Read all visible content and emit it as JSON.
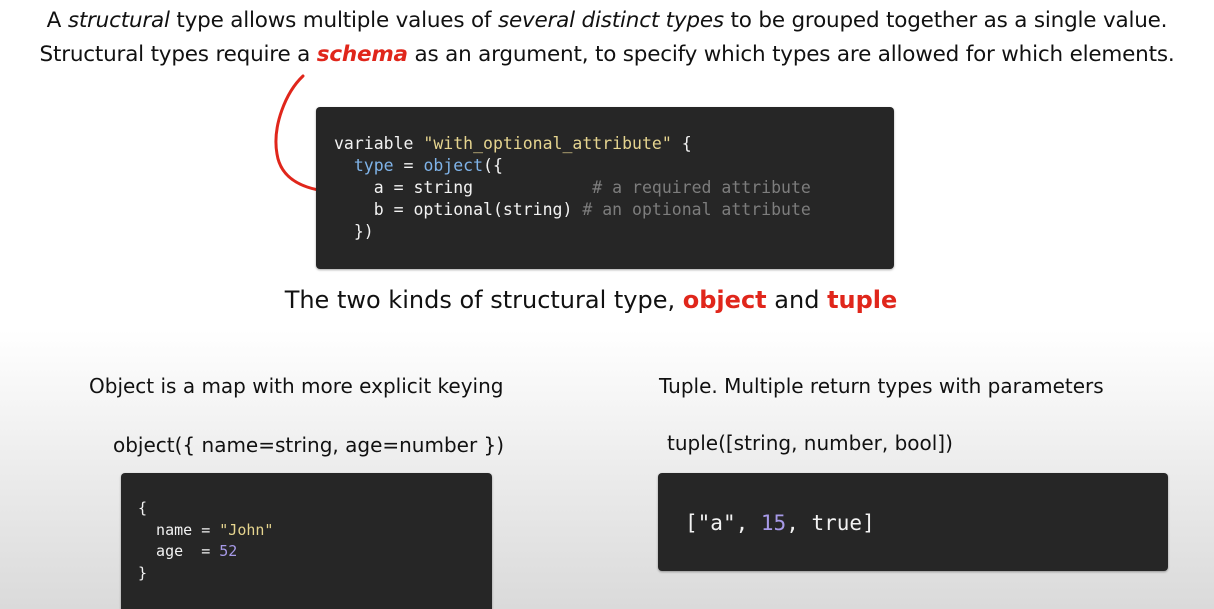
{
  "intro": {
    "l1_a": "A ",
    "l1_b": "structural",
    "l1_c": " type allows multiple values of ",
    "l1_d": "several distinct types",
    "l1_e": " to be grouped together as a single value.",
    "l2_a": "Structural types require a ",
    "l2_b": "schema",
    "l2_c": " as an argument, to specify which types are allowed for which elements."
  },
  "main_code": {
    "lines": [
      [
        "variable ",
        "\"with_optional_attribute\"",
        " {"
      ],
      [
        "  ",
        "type",
        " = ",
        "object",
        "({"
      ],
      [
        "    a = string            ",
        "# a required attribute"
      ],
      [
        "    b = optional(string) ",
        "# an optional attribute"
      ],
      [
        "  })"
      ]
    ]
  },
  "subtitle": {
    "a": "The two kinds of structural type, ",
    "b": "object",
    "c": " and ",
    "d": "tuple"
  },
  "object_col": {
    "heading": "Object is a map with more explicit keying",
    "signature": "object({ name=string, age=number })",
    "code": [
      "{",
      "  name = ",
      "\"John\"",
      "  age  = ",
      "52",
      "}"
    ]
  },
  "tuple_col": {
    "heading": "Tuple. Multiple return types with parameters",
    "signature": "tuple([string, number, bool])",
    "code": [
      "[",
      "\"a\"",
      ", ",
      "15",
      ", ",
      "true",
      "]"
    ]
  },
  "colors": {
    "accent": "#e0261b",
    "code_bg": "#262626",
    "string": "#e5d48f",
    "keyword": "#7fb3e8",
    "comment": "#7d7d7d",
    "number": "#a79ae8"
  }
}
